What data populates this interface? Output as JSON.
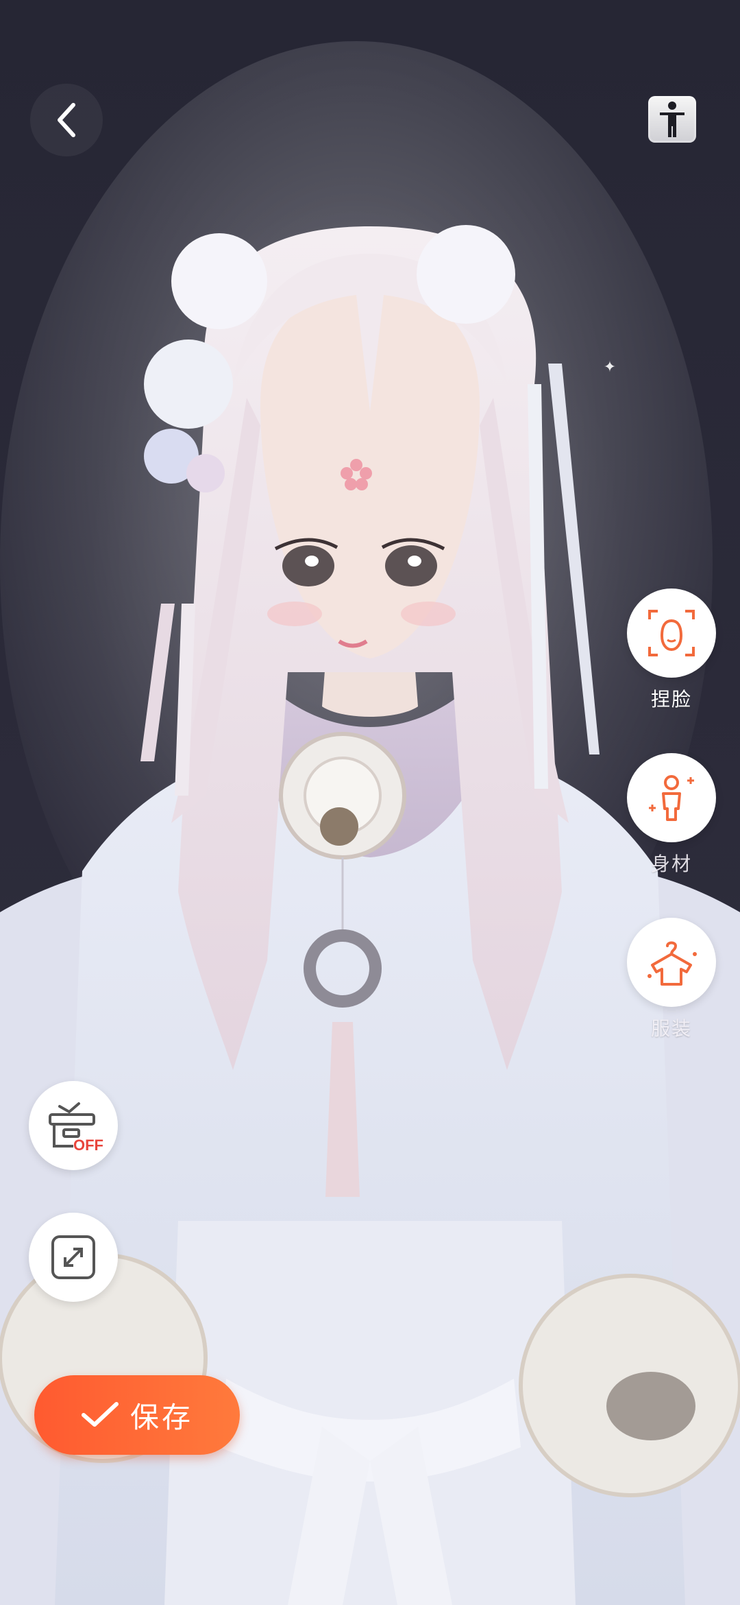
{
  "top_bar": {
    "back_icon": "chevron-left-icon",
    "pose_icon": "standing-figure-icon"
  },
  "side_tools": [
    {
      "label": "捏脸",
      "icon": "face-sculpt-icon"
    },
    {
      "label": "身材",
      "icon": "body-shape-icon"
    },
    {
      "label": "服装",
      "icon": "clothes-hanger-icon"
    }
  ],
  "left_tools": {
    "toggle_badge": "OFF",
    "toggle_icon": "background-off-icon",
    "expand_icon": "expand-arrows-icon"
  },
  "save_button": {
    "label": "保存",
    "icon": "checkmark-icon"
  },
  "colors": {
    "accent": "#FF6A35",
    "background": "#2B2A38",
    "icon_orange": "#F26A3C"
  }
}
